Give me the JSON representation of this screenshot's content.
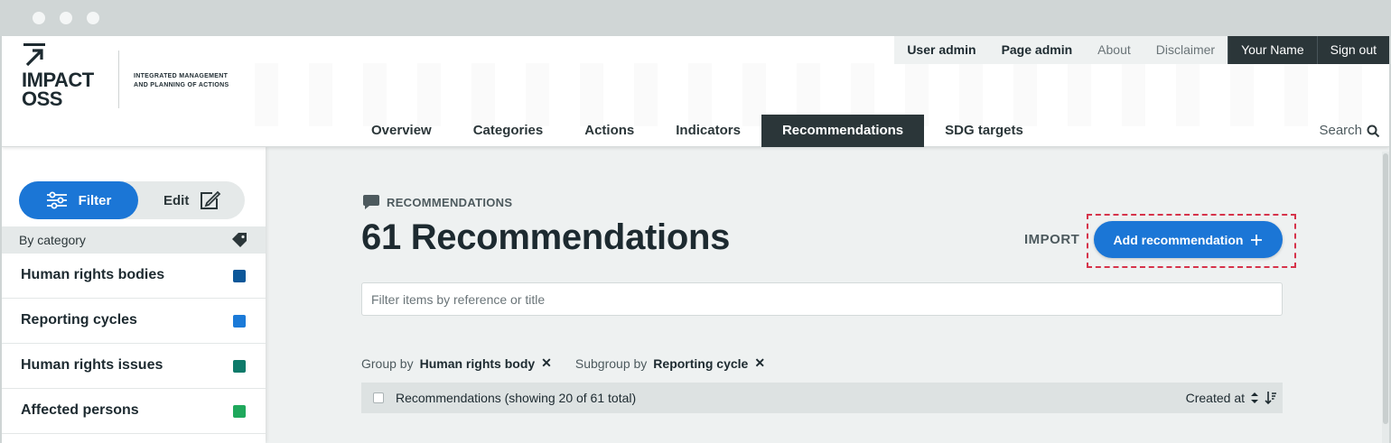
{
  "header": {
    "logo_text_line1": "IMPACT",
    "logo_text_line2": "OSS",
    "tagline_line1": "INTEGRATED MANAGEMENT",
    "tagline_line2": "AND PLANNING OF ACTIONS",
    "top_links": [
      {
        "label": "User admin"
      },
      {
        "label": "Page admin"
      },
      {
        "label": "About"
      },
      {
        "label": "Disclaimer"
      },
      {
        "label": "Your Name"
      },
      {
        "label": "Sign out"
      }
    ],
    "main_nav": [
      {
        "label": "Overview"
      },
      {
        "label": "Categories"
      },
      {
        "label": "Actions"
      },
      {
        "label": "Indicators"
      },
      {
        "label": "Recommendations",
        "active": true
      },
      {
        "label": "SDG targets"
      }
    ],
    "search_label": "Search"
  },
  "sidebar": {
    "filter_label": "Filter",
    "edit_label": "Edit",
    "by_category_label": "By category",
    "categories": [
      {
        "label": "Human rights bodies",
        "color": "#0c5799"
      },
      {
        "label": "Reporting cycles",
        "color": "#1b7ad8"
      },
      {
        "label": "Human rights issues",
        "color": "#0e7a6a"
      },
      {
        "label": "Affected persons",
        "color": "#1fa85c"
      }
    ]
  },
  "main": {
    "section_label": "RECOMMENDATIONS",
    "title": "61 Recommendations",
    "import_label": "IMPORT",
    "add_button_label": "Add recommendation",
    "filter_placeholder": "Filter items by reference or title",
    "group_by_label": "Group by",
    "group_by_value": "Human rights body",
    "subgroup_by_label": "Subgroup by",
    "subgroup_by_value": "Reporting cycle",
    "list_header_label": "Recommendations (showing 20 of 61 total)",
    "sort_label": "Created at"
  },
  "colors": {
    "accent": "#1b76d6",
    "dark": "#2b3639",
    "highlight": "#d6334a"
  }
}
